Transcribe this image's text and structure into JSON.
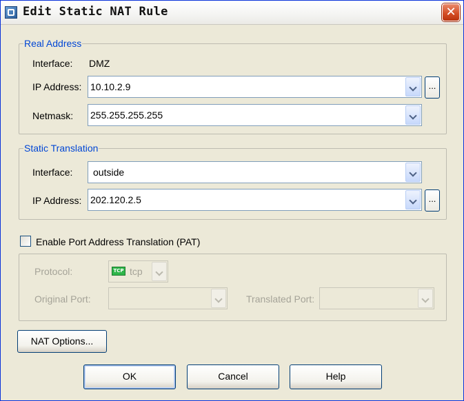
{
  "window": {
    "title": "Edit Static NAT Rule",
    "close_glyph": "✕"
  },
  "real_address": {
    "legend": "Real Address",
    "interface_label": "Interface:",
    "interface_value": "DMZ",
    "ip_label": "IP Address:",
    "ip_value": "10.10.2.9",
    "netmask_label": "Netmask:",
    "netmask_value": "255.255.255.255",
    "browse_label": "..."
  },
  "static_translation": {
    "legend": "Static Translation",
    "interface_label": "Interface:",
    "interface_value": "outside",
    "ip_label": "IP Address:",
    "ip_value": "202.120.2.5",
    "browse_label": "..."
  },
  "pat": {
    "checkbox_label": "Enable Port Address Translation (PAT)",
    "checked": false,
    "protocol_label": "Protocol:",
    "protocol_badge": "TCP",
    "protocol_value": "tcp",
    "original_port_label": "Original Port:",
    "original_port_value": "",
    "translated_port_label": "Translated Port:",
    "translated_port_value": ""
  },
  "buttons": {
    "nat_options": "NAT Options...",
    "ok": "OK",
    "cancel": "Cancel",
    "help": "Help"
  }
}
